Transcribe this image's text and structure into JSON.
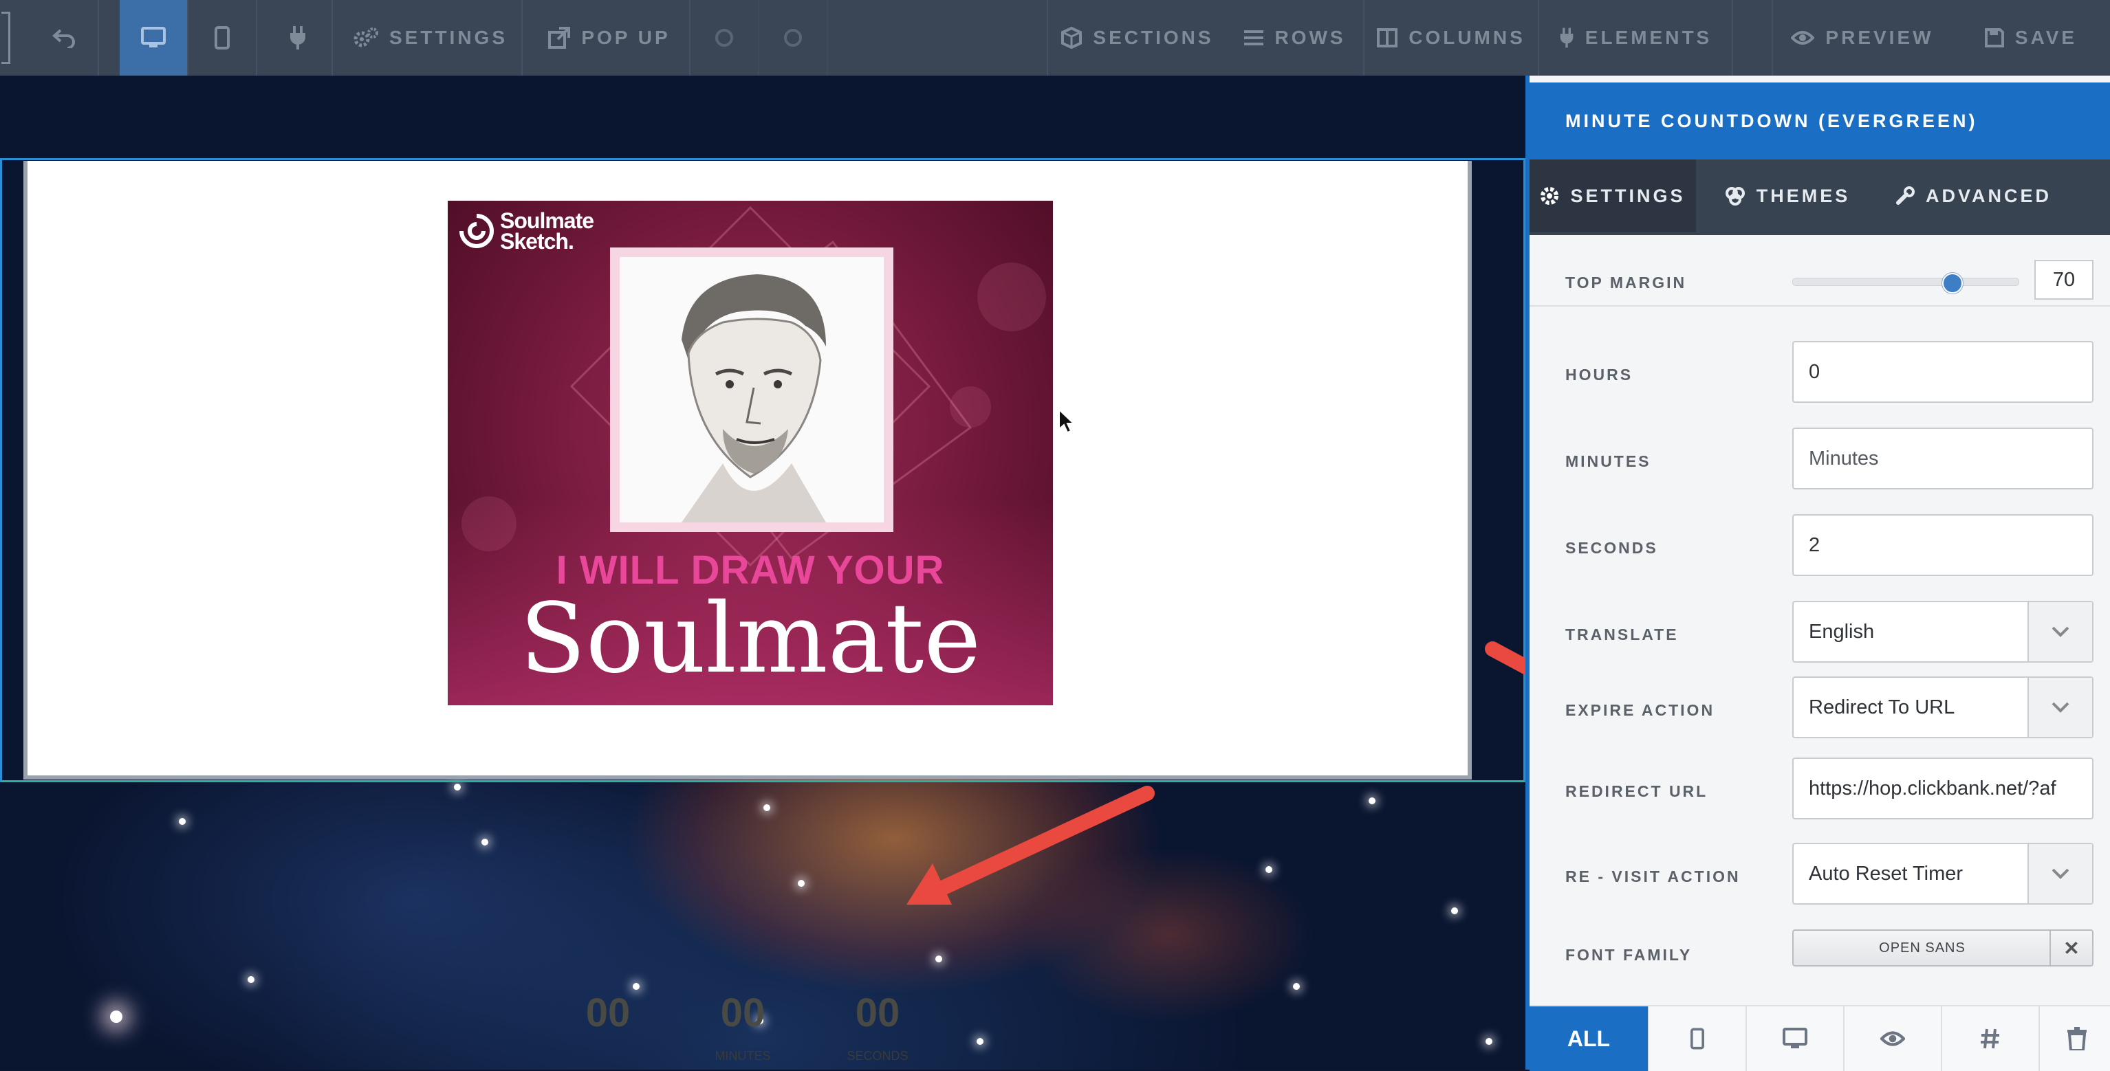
{
  "toolbar": {
    "undo": "undo",
    "desktop": "desktop",
    "mobile": "mobile",
    "plugin": "plugin",
    "settings": "SETTINGS",
    "popup": "POP UP",
    "sections": "SECTIONS",
    "rows": "ROWS",
    "columns": "COLUMNS",
    "elements": "ELEMENTS",
    "preview": "PREVIEW",
    "save": "SAVE"
  },
  "banner": {
    "logo_line1": "Soulmate",
    "logo_line2": "Sketch.",
    "tagline": "I WILL DRAW YOUR",
    "headline": "Soulmate"
  },
  "countdown": {
    "hours": "00",
    "minutes": "00",
    "seconds": "00",
    "minutes_label": "MINUTES",
    "seconds_label": "SECONDS"
  },
  "panel": {
    "title": "MINUTE COUNTDOWN (EVERGREEN)",
    "tabs": {
      "settings": "SETTINGS",
      "themes": "THEMES",
      "advanced": "ADVANCED"
    },
    "top_margin": {
      "label": "TOP MARGIN",
      "value": "70",
      "fraction": 0.7
    },
    "hours": {
      "label": "HOURS",
      "value": "0"
    },
    "minutes": {
      "label": "MINUTES",
      "placeholder": "Minutes"
    },
    "seconds": {
      "label": "SECONDS",
      "value": "2"
    },
    "translate": {
      "label": "TRANSLATE",
      "value": "English"
    },
    "expire_action": {
      "label": "EXPIRE ACTION",
      "value": "Redirect To URL"
    },
    "redirect_url": {
      "label": "REDIRECT URL",
      "value": "https://hop.clickbank.net/?af"
    },
    "revisit_action": {
      "label": "RE - VISIT ACTION",
      "value": "Auto Reset Timer"
    },
    "font_family": {
      "label": "FONT FAMILY",
      "value": "OPEN SANS",
      "clear": "✕"
    },
    "bottom": {
      "all": "ALL"
    }
  },
  "colors": {
    "accent": "#1a6fc4",
    "toolbar": "#3a4656",
    "arrow": "#e9493f"
  }
}
